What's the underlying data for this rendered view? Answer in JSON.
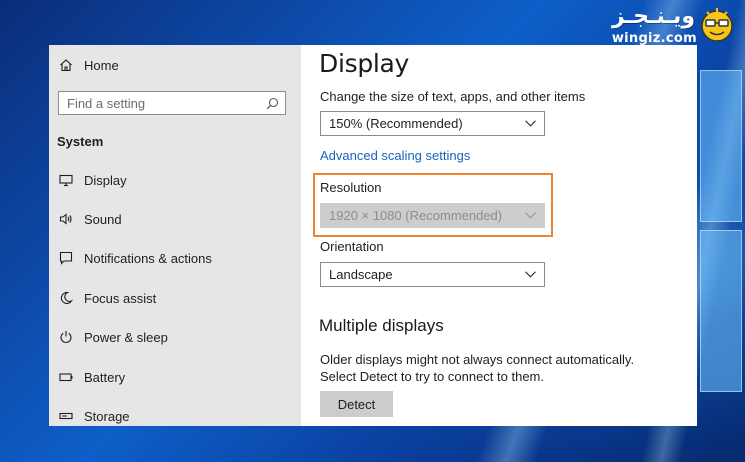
{
  "brand": {
    "script_text": "ويـنـجـز",
    "url": "wingiz.com"
  },
  "sidebar": {
    "home_label": "Home",
    "search_placeholder": "Find a setting",
    "section_label": "System",
    "items": [
      {
        "label": "Display",
        "icon": "monitor-icon"
      },
      {
        "label": "Sound",
        "icon": "speaker-icon"
      },
      {
        "label": "Notifications & actions",
        "icon": "notification-icon"
      },
      {
        "label": "Focus assist",
        "icon": "moon-icon"
      },
      {
        "label": "Power & sleep",
        "icon": "power-icon"
      },
      {
        "label": "Battery",
        "icon": "battery-icon"
      },
      {
        "label": "Storage",
        "icon": "storage-icon"
      }
    ]
  },
  "main": {
    "title": "Display",
    "scale_label": "Change the size of text, apps, and other items",
    "scale_value": "150% (Recommended)",
    "advanced_link": "Advanced scaling settings",
    "resolution_label": "Resolution",
    "resolution_value": "1920 × 1080 (Recommended)",
    "orientation_label": "Orientation",
    "orientation_value": "Landscape",
    "multiple_title": "Multiple displays",
    "multiple_desc": "Older displays might not always connect automatically. Select Detect to try to connect to them.",
    "detect_label": "Detect"
  },
  "colors": {
    "highlight_border": "#f0832c",
    "link": "#1a63b8",
    "sidebar_bg": "#e6e6e6",
    "desktop_blue": "#0e5fc9"
  }
}
